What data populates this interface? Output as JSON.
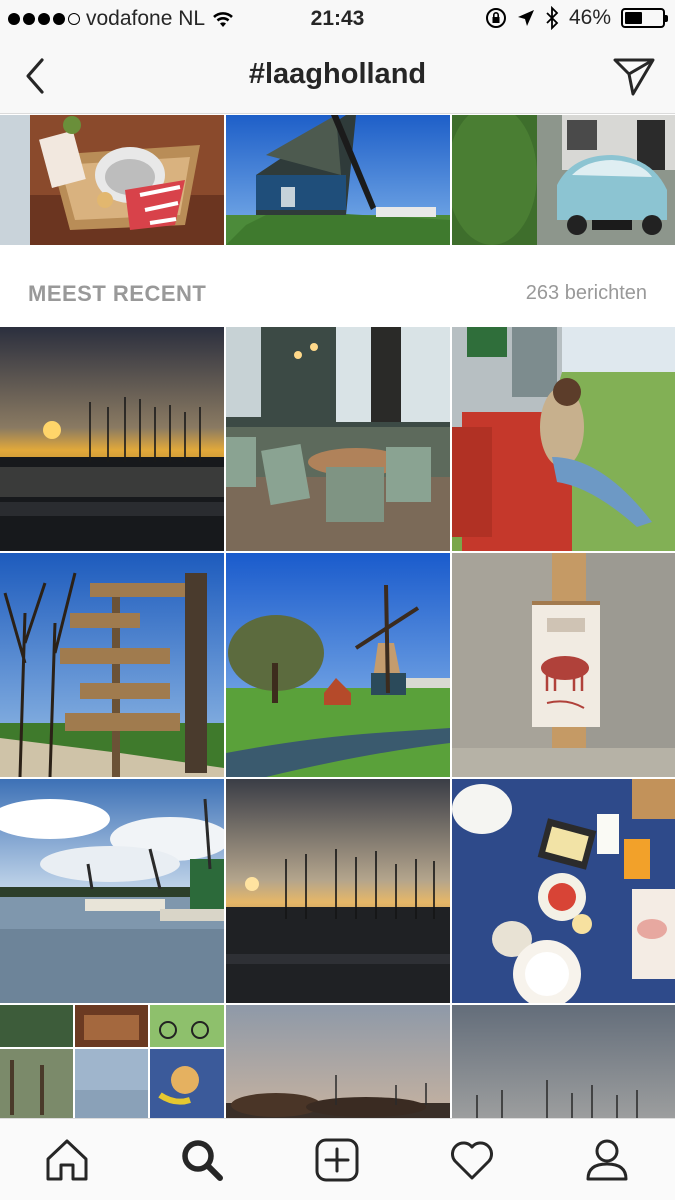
{
  "status_bar": {
    "carrier": "vodafone NL",
    "time": "21:43",
    "battery": "46%",
    "battery_level": 0.46,
    "signal_bars_filled": 4,
    "signal_bars_total": 5
  },
  "header": {
    "title": "#laagholland",
    "back_icon": "chevron-left-icon",
    "direct_icon": "paper-plane-icon"
  },
  "top_posts": [
    {
      "subject": "bread-basket"
    },
    {
      "subject": "windmill"
    },
    {
      "subject": "blue-citroen-car"
    }
  ],
  "recent_section": {
    "title": "MEEST RECENT",
    "count": "263 berichten"
  },
  "recent_posts": [
    {
      "subject": "harbor-sunset"
    },
    {
      "subject": "cafe-interior"
    },
    {
      "subject": "woman-on-red-bench"
    },
    {
      "subject": "signpost-trees"
    },
    {
      "subject": "windmill-meadow"
    },
    {
      "subject": "fresh-milk-poster"
    },
    {
      "subject": "zaanse-schans-windmills"
    },
    {
      "subject": "harbor-dusk"
    },
    {
      "subject": "breakfast-table"
    },
    {
      "subject": "collage"
    },
    {
      "subject": "harbor-sunset-2"
    },
    {
      "subject": "harbor-sky"
    }
  ],
  "tab_bar": {
    "tabs": [
      {
        "icon": "home-icon"
      },
      {
        "icon": "search-icon",
        "active": true
      },
      {
        "icon": "add-post-icon"
      },
      {
        "icon": "heart-icon"
      },
      {
        "icon": "profile-icon"
      }
    ]
  },
  "colors": {
    "bar_background": "#f8f8f8",
    "section_text": "#999999",
    "primary_text": "#262626"
  }
}
